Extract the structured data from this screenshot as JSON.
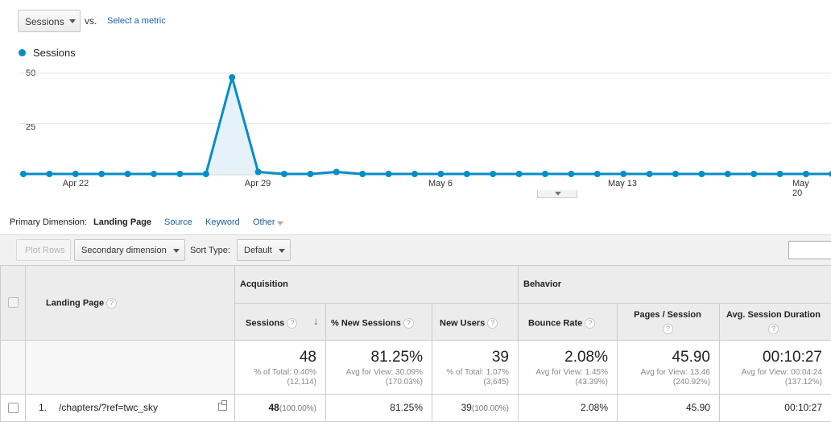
{
  "metric_selector": {
    "value": "Sessions",
    "vs": "vs.",
    "select_metric": "Select a metric"
  },
  "legend": {
    "label": "Sessions",
    "color": "#058dc7"
  },
  "chart_data": {
    "type": "area",
    "series": [
      {
        "name": "Sessions",
        "values": [
          0,
          0,
          0,
          0,
          0,
          0,
          0,
          0,
          48,
          1,
          0,
          0,
          1,
          0,
          0,
          0,
          0,
          0,
          0,
          0,
          0,
          0,
          0,
          0,
          0,
          0,
          0,
          0,
          0,
          0,
          0,
          0,
          0
        ]
      }
    ],
    "y_ticks": [
      "50",
      "25"
    ],
    "ylim": [
      0,
      50
    ],
    "x_ticks": [
      "Apr 22",
      "Apr 29",
      "May 6",
      "May 13",
      "May 20"
    ],
    "grid": true,
    "color": "#058dc7"
  },
  "primary_dimension": {
    "label": "Primary Dimension:",
    "items": [
      "Landing Page",
      "Source",
      "Keyword",
      "Other"
    ]
  },
  "toolbar": {
    "plot_rows": "Plot Rows",
    "secondary_dimension": "Secondary dimension",
    "sort_type_label": "Sort Type:",
    "sort_type_value": "Default"
  },
  "table": {
    "dimension_header": "Landing Page",
    "group_acquisition": "Acquisition",
    "group_behavior": "Behavior",
    "columns": [
      "Sessions",
      "% New Sessions",
      "New Users",
      "Bounce Rate",
      "Pages / Session",
      "Avg. Session Duration"
    ],
    "totals": [
      {
        "big": "48",
        "sub1": "% of Total: 0.40%",
        "sub2": "(12,114)"
      },
      {
        "big": "81.25%",
        "sub1": "Avg for View: 30.09%",
        "sub2": "(170.03%)"
      },
      {
        "big": "39",
        "sub1": "% of Total: 1.07%",
        "sub2": "(3,645)"
      },
      {
        "big": "2.08%",
        "sub1": "Avg for View: 1.45%",
        "sub2": "(43.39%)"
      },
      {
        "big": "45.90",
        "sub1": "Avg for View: 13.46",
        "sub2": "(240.92%)"
      },
      {
        "big": "00:10:27",
        "sub1": "Avg for View: 00:04:24",
        "sub2": "(137.12%)"
      }
    ],
    "rows": [
      {
        "index": "1.",
        "page": "/chapters/?ref=twc_sky",
        "sessions": "48",
        "sessions_pct": "(100.00%)",
        "new_sessions": "81.25%",
        "new_users": "39",
        "new_users_pct": "(100.00%)",
        "bounce_rate": "2.08%",
        "pages_session": "45.90",
        "duration": "00:10:27"
      }
    ]
  }
}
